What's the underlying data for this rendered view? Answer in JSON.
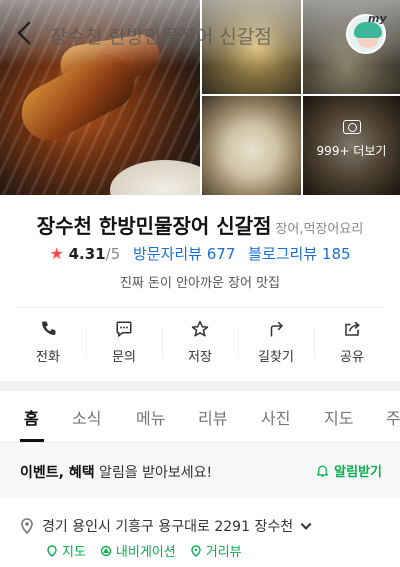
{
  "header": {
    "title": "장수천 한방민물장어 신갈점",
    "my_label": "my"
  },
  "photos": {
    "more_label": "999+ 더보기"
  },
  "place": {
    "name": "장수천 한방민물장어 신갈점",
    "category": "장어,먹장어요리",
    "rating": "4.31",
    "rating_max": "/5",
    "visitor_reviews": "방문자리뷰 677",
    "blog_reviews": "블로그리뷰 185",
    "description": "진짜 돈이 안아까운 장어 맛집"
  },
  "actions": [
    {
      "label": "전화",
      "icon": "phone-icon"
    },
    {
      "label": "문의",
      "icon": "chat-icon"
    },
    {
      "label": "저장",
      "icon": "star-icon"
    },
    {
      "label": "길찾기",
      "icon": "directions-icon"
    },
    {
      "label": "공유",
      "icon": "share-icon"
    }
  ],
  "tabs": [
    "홈",
    "소식",
    "메뉴",
    "리뷰",
    "사진",
    "지도",
    "주"
  ],
  "active_tab": "홈",
  "banner": {
    "bold1": "이벤트",
    "sep": ", ",
    "bold2": "혜택",
    "rest": " 알림을 받아보세요!",
    "action": "알림받기"
  },
  "address": {
    "text": "경기 용인시 기흥구 용구대로 2291 장수천",
    "links": [
      "지도",
      "내비게이션",
      "거리뷰"
    ]
  },
  "colors": {
    "accent_green": "#06b04a",
    "link_blue": "#1a6fd8",
    "star_red": "#ff4b4b"
  }
}
